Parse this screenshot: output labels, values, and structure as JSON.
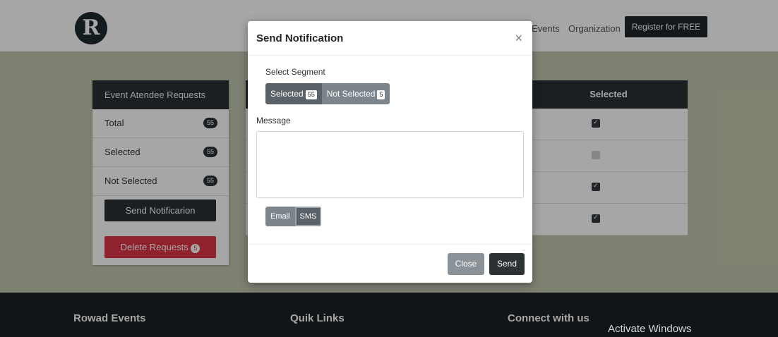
{
  "header": {
    "logo_letter": "R",
    "nav": [
      "Events",
      "Organization"
    ],
    "register_label": "Register for FREE"
  },
  "sidebar": {
    "title": "Event Atendee Requests",
    "items": [
      {
        "label": "Total",
        "count": "55"
      },
      {
        "label": "Selected",
        "count": "55"
      },
      {
        "label": "Not Selected",
        "count": "55"
      }
    ],
    "send_label": "Send Notificarion",
    "delete_label": "Delete Requests",
    "delete_count": "5"
  },
  "table": {
    "selected_header": "Selected",
    "rows": [
      true,
      false,
      true,
      true
    ]
  },
  "footer": {
    "col1": "Rowad Events",
    "col2": "Quik Links",
    "col3": "Connect with us"
  },
  "watermark": "Activate Windows",
  "modal": {
    "title": "Send Notification",
    "close_icon": "×",
    "segment_label": "Select Segment",
    "segments": [
      {
        "label": "Selected",
        "count": "55"
      },
      {
        "label": "Not Selected",
        "count": "5"
      }
    ],
    "message_label": "Message",
    "message_value": "",
    "channels": [
      "Email",
      "SMS"
    ],
    "close_label": "Close",
    "send_label": "Send"
  },
  "colors": {
    "primary_dark": "#2c3134",
    "danger": "#dc3545",
    "secondary": "#7c858c"
  }
}
